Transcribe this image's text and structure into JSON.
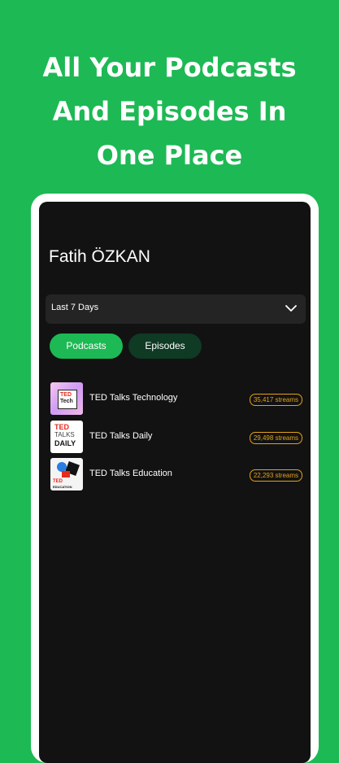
{
  "promo": {
    "headline_lines": [
      "All Your Podcasts",
      "And Episodes In",
      "One Place"
    ]
  },
  "colors": {
    "background": "#1db954",
    "screen": "#121212",
    "accent_green": "#1db954",
    "badge_orange": "#e3a21a"
  },
  "profile": {
    "name": "Fatih ÖZKAN"
  },
  "date_range": {
    "selected": "Last 7 Days",
    "icon": "chevron-down-icon"
  },
  "tabs": [
    {
      "label": "Podcasts",
      "active": true
    },
    {
      "label": "Episodes",
      "active": false
    }
  ],
  "podcasts": [
    {
      "name": "TED Talks Technology",
      "streams": "35,417 streams",
      "cover_text": [
        "TED",
        "Tech"
      ]
    },
    {
      "name": "TED Talks Daily",
      "streams": "29,498 streams",
      "cover_text": [
        "TED",
        "TALKS",
        "DAILY"
      ]
    },
    {
      "name": "TED Talks Education",
      "streams": "22,293 streams",
      "cover_text": [
        "TED",
        "EDUCATION"
      ]
    }
  ]
}
